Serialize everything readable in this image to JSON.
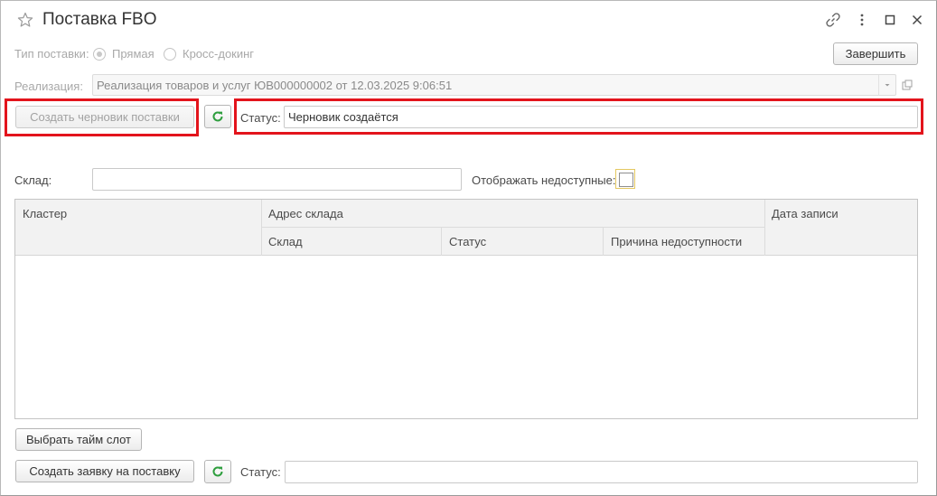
{
  "window": {
    "title": "Поставка FBO"
  },
  "delivery_type": {
    "label": "Тип поставки:",
    "options": [
      "Прямая",
      "Кросс-докинг"
    ],
    "selected": "Прямая"
  },
  "finish_button": "Завершить",
  "realization": {
    "label": "Реализация:",
    "value": "Реализация товаров и услуг ЮВ000000002 от 12.03.2025 9:06:51"
  },
  "draft": {
    "create_button": "Создать черновик поставки",
    "status_label": "Статус:",
    "status_value": "Черновик создаётся"
  },
  "warehouse": {
    "label": "Склад:",
    "value": "",
    "show_unavailable_label": "Отображать недоступные:",
    "show_unavailable": false
  },
  "table": {
    "headers": {
      "cluster": "Кластер",
      "address_group": "Адрес склада",
      "warehouse": "Склад",
      "status": "Статус",
      "reason": "Причина недоступности",
      "record_date": "Дата записи"
    },
    "rows": []
  },
  "timeslot_button": "Выбрать тайм слот",
  "request": {
    "create_button": "Создать заявку на поставку",
    "status_label": "Статус:",
    "status_value": ""
  },
  "colors": {
    "highlight": "#e3141c",
    "refresh_icon": "#2e9e3e"
  }
}
